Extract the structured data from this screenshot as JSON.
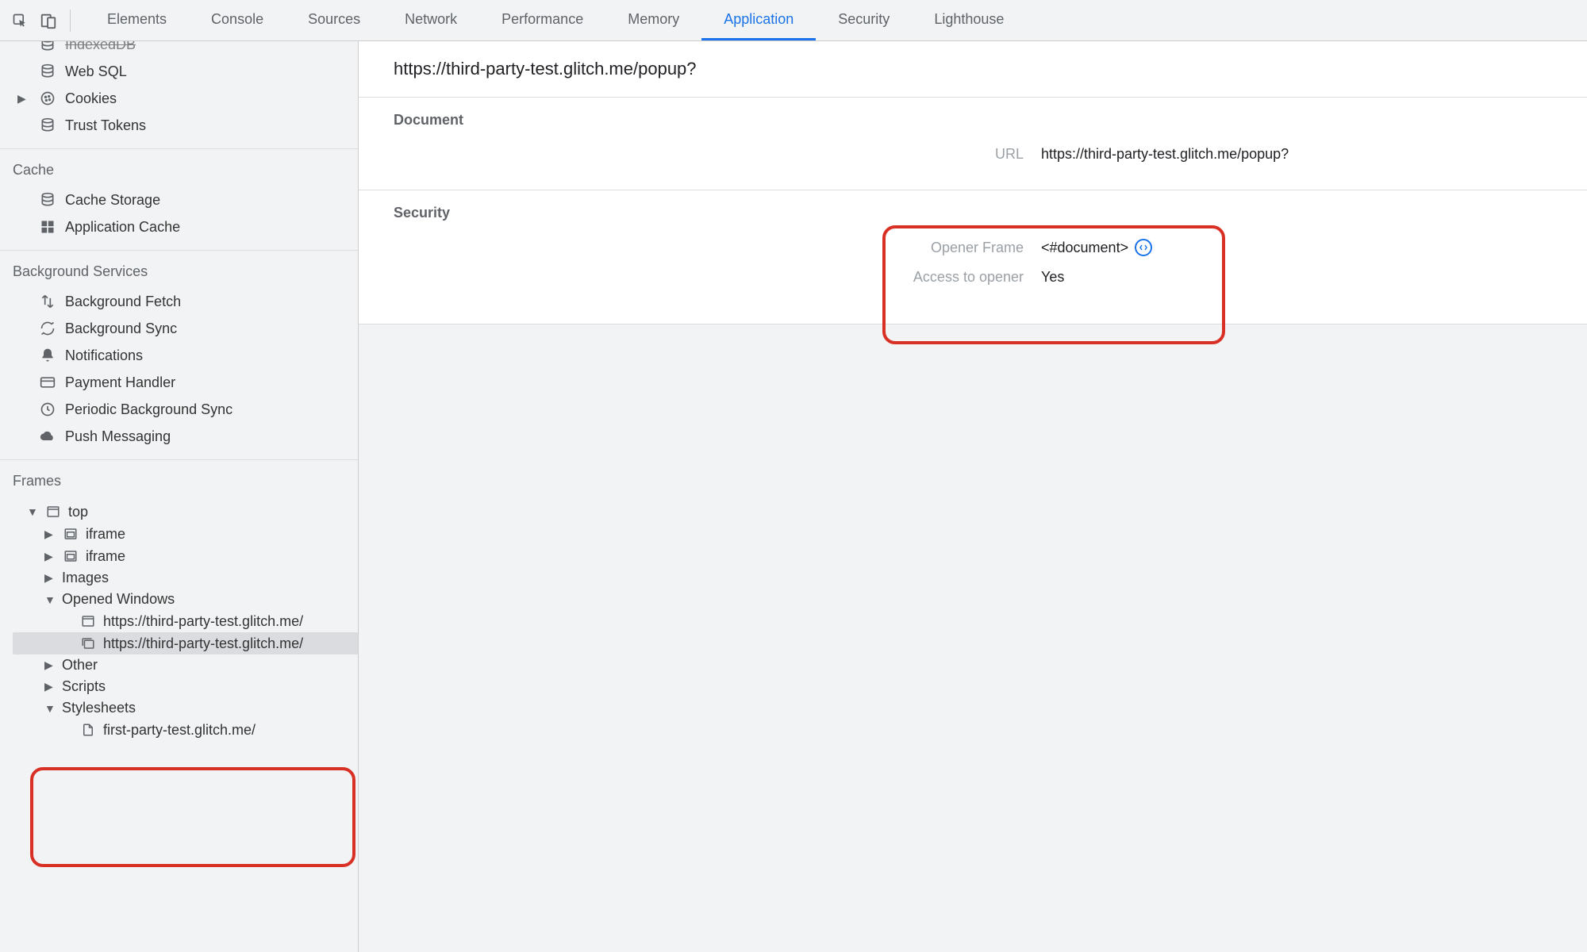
{
  "tabs": {
    "items": [
      "Elements",
      "Console",
      "Sources",
      "Network",
      "Performance",
      "Memory",
      "Application",
      "Security",
      "Lighthouse"
    ],
    "active": "Application"
  },
  "sidebar": {
    "storage_items": {
      "indexeddb": "IndexedDB",
      "websql": "Web SQL",
      "cookies": "Cookies",
      "trust_tokens": "Trust Tokens"
    },
    "cache": {
      "label": "Cache",
      "items": {
        "cache_storage": "Cache Storage",
        "app_cache": "Application Cache"
      }
    },
    "bg": {
      "label": "Background Services",
      "items": {
        "bg_fetch": "Background Fetch",
        "bg_sync": "Background Sync",
        "notifications": "Notifications",
        "payment": "Payment Handler",
        "periodic": "Periodic Background Sync",
        "push": "Push Messaging"
      }
    },
    "frames": {
      "label": "Frames",
      "top": "top",
      "iframe1": "iframe",
      "iframe2": "iframe",
      "images": "Images",
      "opened_windows": "Opened Windows",
      "win1": "https://third-party-test.glitch.me/",
      "win2": "https://third-party-test.glitch.me/",
      "other": "Other",
      "scripts": "Scripts",
      "stylesheets": "Stylesheets",
      "sheet1": "first-party-test.glitch.me/"
    }
  },
  "content": {
    "title": "https://third-party-test.glitch.me/popup?",
    "document": {
      "label": "Document",
      "url_key": "URL",
      "url_val": "https://third-party-test.glitch.me/popup?"
    },
    "security": {
      "label": "Security",
      "opener_frame_key": "Opener Frame",
      "opener_frame_val": "<#document>",
      "access_key": "Access to opener",
      "access_val": "Yes"
    }
  }
}
